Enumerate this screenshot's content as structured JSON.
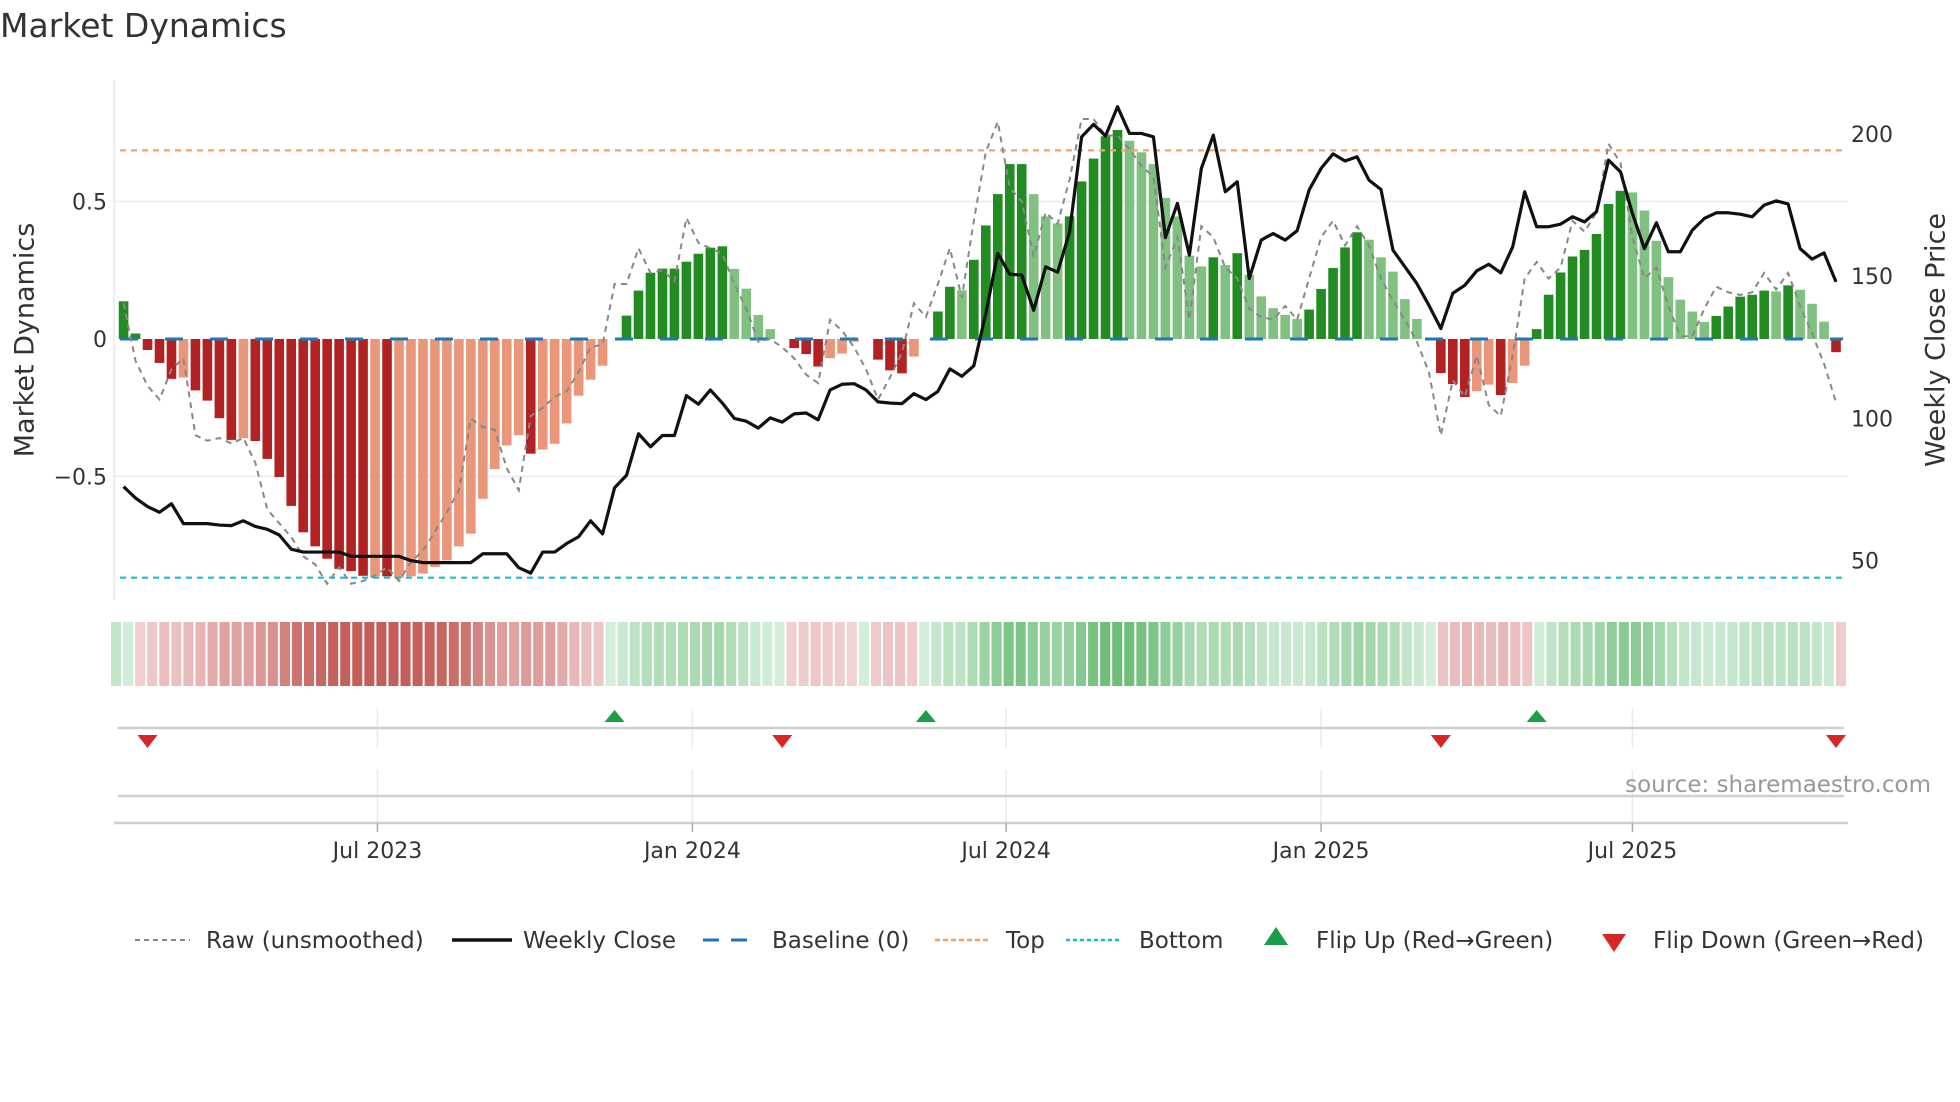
{
  "title": "Market Dynamics",
  "source": "source: sharemaestro.com",
  "legend": {
    "raw": "Raw (unsmoothed)",
    "close": "Weekly Close",
    "baseline": "Baseline (0)",
    "top": "Top",
    "bottom": "Bottom",
    "flip_up": "Flip Up (Red→Green)",
    "flip_down": "Flip Down (Green→Red)"
  },
  "colors": {
    "strong_green": "#228b22",
    "weak_green": "#80c080",
    "strong_red": "#b22222",
    "weak_red": "#e9967a",
    "raw": "#888888",
    "close": "#111111",
    "baseline": "#1f77b4",
    "top": "#f4a460",
    "bottom": "#17becf",
    "flip_up": "#1a9e4a",
    "flip_down": "#d62728"
  },
  "chart_data": {
    "type": "bar",
    "title": "Market Dynamics",
    "ylabel": "Market Dynamics",
    "y2label": "Weekly Close Price",
    "ylim": [
      -0.95,
      0.95
    ],
    "y2lim": [
      40,
      217
    ],
    "yticks": [
      {
        "v": 0.5,
        "label": "0.5"
      },
      {
        "v": 0,
        "label": "0"
      },
      {
        "v": -0.5,
        "label": "−0.5"
      }
    ],
    "y2ticks": [
      {
        "v": 200,
        "label": "200"
      },
      {
        "v": 150,
        "label": "150"
      },
      {
        "v": 100,
        "label": "100"
      },
      {
        "v": 50,
        "label": "50"
      }
    ],
    "xlim": [
      -0.8,
      144
    ],
    "xticks": [
      {
        "v": 21.2,
        "label": "Jul 2023"
      },
      {
        "v": 47.5,
        "label": "Jan 2024"
      },
      {
        "v": 73.7,
        "label": "Jul 2024"
      },
      {
        "v": 100.0,
        "label": "Jan 2025"
      },
      {
        "v": 126.0,
        "label": "Jul 2025"
      }
    ],
    "top_level": 0.686,
    "bottom_level": -0.868,
    "baseline": 0,
    "bars": [
      0.137,
      0.02,
      -0.04,
      -0.087,
      -0.145,
      -0.14,
      -0.187,
      -0.224,
      -0.288,
      -0.367,
      -0.361,
      -0.371,
      -0.436,
      -0.502,
      -0.607,
      -0.703,
      -0.754,
      -0.799,
      -0.836,
      -0.844,
      -0.861,
      -0.863,
      -0.863,
      -0.868,
      -0.863,
      -0.853,
      -0.829,
      -0.805,
      -0.754,
      -0.708,
      -0.581,
      -0.473,
      -0.387,
      -0.35,
      -0.417,
      -0.402,
      -0.381,
      -0.307,
      -0.206,
      -0.148,
      -0.097,
      0.0,
      0.085,
      0.176,
      0.241,
      0.256,
      0.256,
      0.281,
      0.31,
      0.332,
      0.337,
      0.255,
      0.183,
      0.087,
      0.036,
      0.0,
      -0.033,
      -0.055,
      -0.1,
      -0.07,
      -0.053,
      -0.01,
      0.0,
      -0.075,
      -0.114,
      -0.125,
      -0.064,
      0.0,
      0.1,
      0.19,
      0.177,
      0.288,
      0.413,
      0.527,
      0.636,
      0.636,
      0.527,
      0.446,
      0.42,
      0.446,
      0.573,
      0.656,
      0.737,
      0.76,
      0.721,
      0.679,
      0.636,
      0.513,
      0.446,
      0.303,
      0.264,
      0.297,
      0.269,
      0.312,
      0.234,
      0.155,
      0.112,
      0.088,
      0.073,
      0.107,
      0.182,
      0.258,
      0.333,
      0.388,
      0.361,
      0.297,
      0.245,
      0.145,
      0.073,
      0.0,
      -0.124,
      -0.164,
      -0.211,
      -0.19,
      -0.166,
      -0.204,
      -0.16,
      -0.097,
      0.036,
      0.161,
      0.242,
      0.3,
      0.324,
      0.382,
      0.491,
      0.539,
      0.533,
      0.467,
      0.357,
      0.225,
      0.143,
      0.1,
      0.062,
      0.084,
      0.118,
      0.154,
      0.161,
      0.176,
      0.173,
      0.195,
      0.179,
      0.128,
      0.063,
      -0.048
    ],
    "strength": "SSSSSWSSSSWSSSSSSSSSSWSWWWWWWWWWWWSWWWWWWWSSSSSSSSSWWWWWSSSWWWWSSSWWSSWSSSSSWWWSSSSSWWWWWWWSWSWWWWWSSSSSWWWWWWSSSWWSWWSSSSSSSSWWWWWWWSSSSSWSWWWS",
    "raw": [
      0.13,
      -0.08,
      -0.17,
      -0.22,
      -0.11,
      -0.07,
      -0.35,
      -0.37,
      -0.36,
      -0.38,
      -0.36,
      -0.45,
      -0.62,
      -0.67,
      -0.72,
      -0.79,
      -0.82,
      -0.89,
      -0.83,
      -0.89,
      -0.88,
      -0.86,
      -0.83,
      -0.88,
      -0.81,
      -0.77,
      -0.7,
      -0.63,
      -0.55,
      -0.29,
      -0.32,
      -0.33,
      -0.47,
      -0.55,
      -0.28,
      -0.25,
      -0.21,
      -0.19,
      -0.12,
      -0.03,
      -0.02,
      0.2,
      0.2,
      0.33,
      0.24,
      0.25,
      0.21,
      0.44,
      0.35,
      0.33,
      0.31,
      0.2,
      0.11,
      -0.01,
      0.0,
      -0.03,
      -0.07,
      -0.13,
      -0.16,
      0.07,
      0.03,
      -0.03,
      -0.11,
      -0.22,
      -0.14,
      -0.05,
      0.13,
      0.08,
      0.2,
      0.33,
      0.15,
      0.43,
      0.68,
      0.79,
      0.55,
      0.5,
      0.3,
      0.46,
      0.42,
      0.58,
      0.8,
      0.8,
      0.74,
      0.74,
      0.69,
      0.63,
      0.59,
      0.26,
      0.37,
      0.07,
      0.41,
      0.37,
      0.26,
      0.22,
      0.11,
      0.08,
      0.07,
      0.12,
      0.07,
      0.22,
      0.37,
      0.43,
      0.34,
      0.41,
      0.34,
      0.22,
      0.14,
      0.07,
      -0.01,
      -0.12,
      -0.35,
      -0.15,
      -0.21,
      -0.06,
      -0.24,
      -0.28,
      -0.06,
      0.22,
      0.28,
      0.22,
      0.26,
      0.43,
      0.39,
      0.46,
      0.71,
      0.64,
      0.37,
      0.22,
      0.26,
      0.12,
      0.01,
      0.01,
      0.11,
      0.19,
      0.17,
      0.16,
      0.17,
      0.24,
      0.18,
      0.24,
      0.12,
      0.02,
      -0.09,
      -0.23
    ],
    "close": [
      76,
      72,
      69,
      67,
      70,
      63,
      63,
      63,
      62.5,
      62.3,
      64,
      62,
      61,
      59,
      54,
      53,
      53,
      53,
      53,
      51.5,
      51.5,
      51.5,
      51.5,
      51.5,
      50,
      49.3,
      49.3,
      49.3,
      49.3,
      49.3,
      52.4,
      52.4,
      52.4,
      47.5,
      45.6,
      53,
      53,
      56,
      58.4,
      64,
      59.4,
      75.6,
      80,
      94.6,
      90,
      94,
      94,
      108,
      105,
      110,
      105.4,
      100,
      99,
      96.6,
      100.2,
      98.7,
      101.6,
      101.9,
      99.5,
      110,
      112,
      112.2,
      110,
      105.8,
      105.4,
      105.2,
      108.7,
      106.6,
      109.5,
      117.4,
      114.8,
      118.5,
      136.9,
      158,
      150.7,
      150.4,
      138,
      153.3,
      151.4,
      165.6,
      199,
      203.4,
      199.3,
      209.6,
      200.2,
      200.2,
      199,
      163.6,
      175.6,
      157.4,
      187.9,
      199.6,
      179.7,
      183.2,
      149.2,
      162.7,
      165,
      162.7,
      166,
      180.3,
      187.9,
      193,
      190.5,
      192,
      183.8,
      180.5,
      159.2,
      153.3,
      147.4,
      139.8,
      131.6,
      144,
      146.8,
      151.9,
      154.2,
      151.2,
      160.3,
      179.7,
      167.4,
      167.4,
      168.3,
      170.9,
      169.1,
      172.7,
      190.8,
      186.7,
      172,
      159.7,
      168.8,
      158.6,
      158.6,
      166.2,
      170.3,
      172.3,
      172.3,
      171.8,
      170.9,
      175,
      176.5,
      175.4,
      159.7,
      156,
      158.2,
      148
    ],
    "flips_up": [
      41,
      67,
      118
    ],
    "flips_down": [
      2,
      55,
      110,
      143
    ],
    "grid": true,
    "legend_position": "bottom"
  }
}
